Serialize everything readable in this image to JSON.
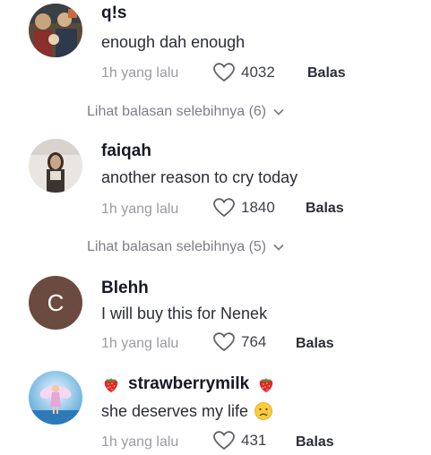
{
  "comments": [
    {
      "username": "q!s",
      "text": "enough dah enough",
      "time": "1h yang lalu",
      "likes": "4032",
      "reply": "Balas",
      "avatar": "photo-avatar"
    },
    {
      "username": "faiqah",
      "text": "another reason to cry today",
      "time": "1h yang lalu",
      "likes": "1840",
      "reply": "Balas",
      "avatar": "photo-avatar"
    },
    {
      "username": "Blehh",
      "text": "I will buy this for Nenek",
      "time": "1h yang lalu",
      "likes": "764",
      "reply": "Balas",
      "avatar_letter": "C",
      "avatar_color": "#6b4a3f"
    },
    {
      "username": "strawberrymilk",
      "text": "she deserves my life",
      "time": "1h yang lalu",
      "likes": "431",
      "reply": "Balas",
      "username_emoji": "strawberry-icon",
      "text_emoji": "sad-face-icon",
      "avatar": "fairy-avatar"
    }
  ],
  "view_more": [
    {
      "label": "Lihat balasan selebihnya (6)",
      "icon": "chevron-down-icon"
    },
    {
      "label": "Lihat balasan selebihnya (5)",
      "icon": "chevron-down-icon"
    }
  ],
  "colors": {
    "text_primary": "#161823",
    "muted": "#9a9ba1",
    "view_more": "#7d7f87"
  }
}
